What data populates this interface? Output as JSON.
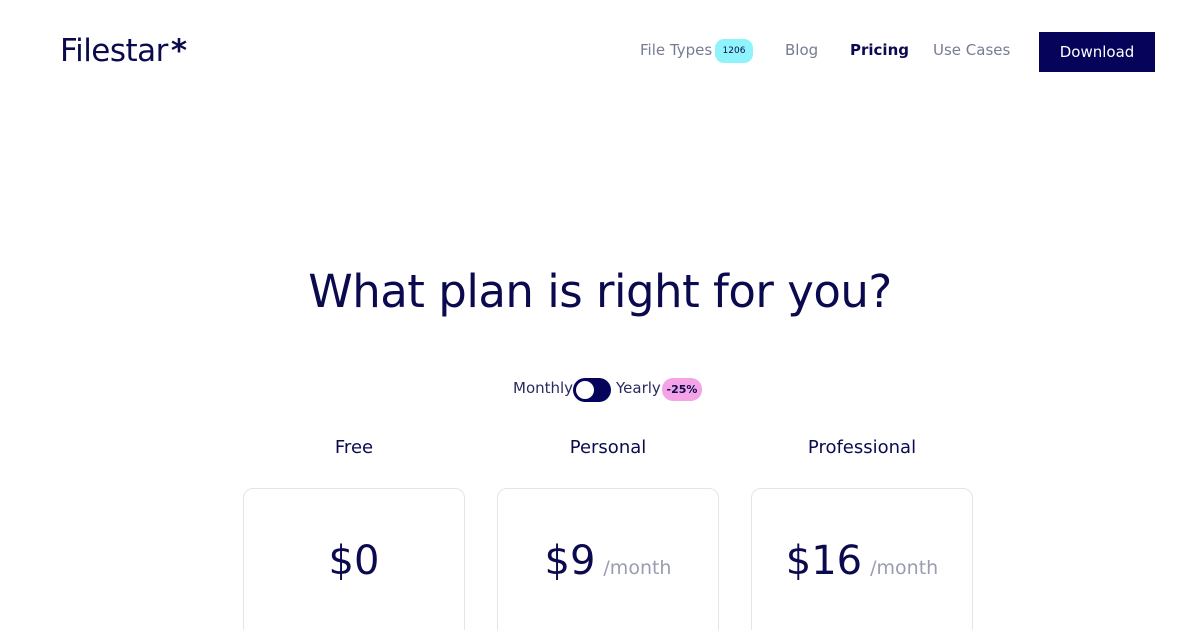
{
  "header": {
    "logo_text": "Filestar",
    "logo_mark": "*",
    "nav": {
      "file_types": "File Types",
      "file_types_count": "1206",
      "blog": "Blog",
      "pricing": "Pricing",
      "use_cases": "Use Cases"
    },
    "download_label": "Download"
  },
  "main": {
    "headline": "What plan is right for you?",
    "billing": {
      "monthly_label": "Monthly",
      "yearly_label": "Yearly",
      "discount": "-25%",
      "selected": "Monthly"
    },
    "plans": [
      {
        "name": "Free",
        "price": "$0",
        "period": ""
      },
      {
        "name": "Personal",
        "price": "$9",
        "period": "/month"
      },
      {
        "name": "Professional",
        "price": "$16",
        "period": "/month"
      }
    ]
  },
  "colors": {
    "brand_navy": "#06045a",
    "text_navy": "#0b0a4f",
    "nav_gray": "#777c91",
    "count_badge": "#8ff3fb",
    "discount_badge": "#f3a3e6",
    "period_gray": "#9a9caf"
  }
}
